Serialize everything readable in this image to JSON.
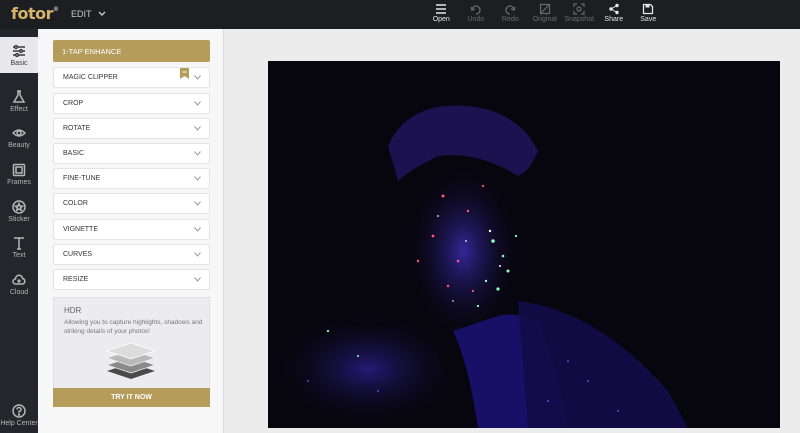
{
  "app": {
    "logo": "fotor",
    "logo_mark": "®",
    "edit_menu": "EDIT"
  },
  "toolbar": {
    "open": "Open",
    "undo": "Undo",
    "redo": "Redo",
    "original": "Original",
    "snapshot": "Snapshot",
    "share": "Share",
    "save": "Save"
  },
  "rail": {
    "basic": "Basic",
    "effect": "Effect",
    "beauty": "Beauty",
    "frames": "Frames",
    "sticker": "Sticker",
    "text": "Text",
    "cloud": "Cloud",
    "help": "Help Center"
  },
  "panel": {
    "enhance": "1-TAP ENHANCE",
    "items": [
      "MAGIC CLIPPER",
      "CROP",
      "ROTATE",
      "BASIC",
      "FINE-TUNE",
      "COLOR",
      "VIGNETTE",
      "CURVES",
      "RESIZE"
    ],
    "hdr": {
      "title": "HDR",
      "description": "Allowing you to capture highlights, shadows and striking details of your photos!",
      "button": "TRY IT NOW"
    }
  },
  "colors": {
    "accent": "#b59c5b",
    "topbar": "#1d1e22",
    "rail": "#25262b"
  }
}
